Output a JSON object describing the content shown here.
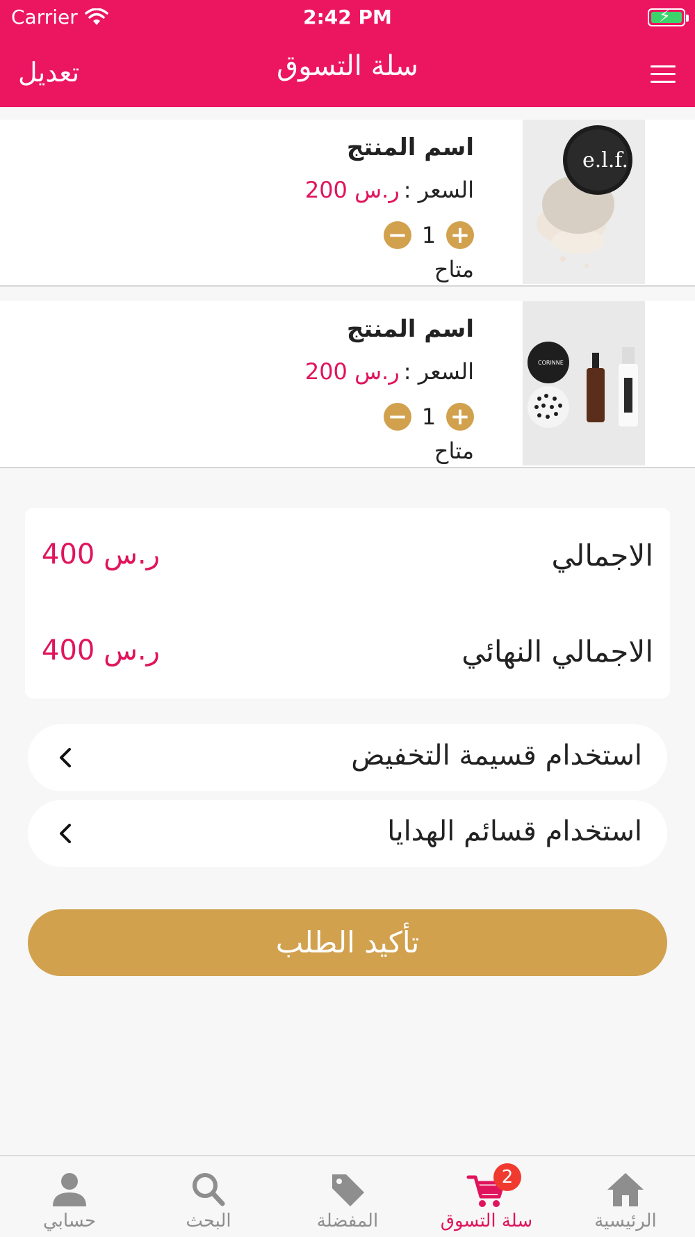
{
  "status_bar": {
    "carrier": "Carrier",
    "time": "2:42 PM"
  },
  "nav": {
    "title": "سلة التسوق",
    "edit_label": "تعديل"
  },
  "cart": {
    "items": [
      {
        "name": "اسم المنتج",
        "price_label": "السعر :",
        "price_value": "ر.س 200",
        "quantity": "1",
        "availability": "متاح",
        "image": "loose-powder-jar-image"
      },
      {
        "name": "اسم المنتج",
        "price_label": "السعر :",
        "price_value": "ر.س 200",
        "quantity": "1",
        "availability": "متاح",
        "image": "cosmetics-set-image"
      }
    ]
  },
  "totals": {
    "subtotal_label": "الاجمالي",
    "subtotal_value": "ر.س 400",
    "grand_total_label": "الاجمالي النهائي",
    "grand_total_value": "ر.س 400"
  },
  "options": {
    "coupon_label": "استخدام قسيمة التخفيض",
    "gift_card_label": "استخدام قسائم الهدايا"
  },
  "confirm_label": "تأكيد الطلب",
  "tabbar": {
    "items": [
      {
        "label": "حسابي",
        "icon": "person-icon"
      },
      {
        "label": "البحث",
        "icon": "search-icon"
      },
      {
        "label": "المفضلة",
        "icon": "tag-icon"
      },
      {
        "label": "سلة التسوق",
        "icon": "cart-icon",
        "active": true,
        "badge": "2"
      },
      {
        "label": "الرئيسية",
        "icon": "home-icon"
      }
    ]
  },
  "colors": {
    "primary": "#ec1560",
    "accent": "#d1a14e",
    "price": "#e0145c"
  }
}
